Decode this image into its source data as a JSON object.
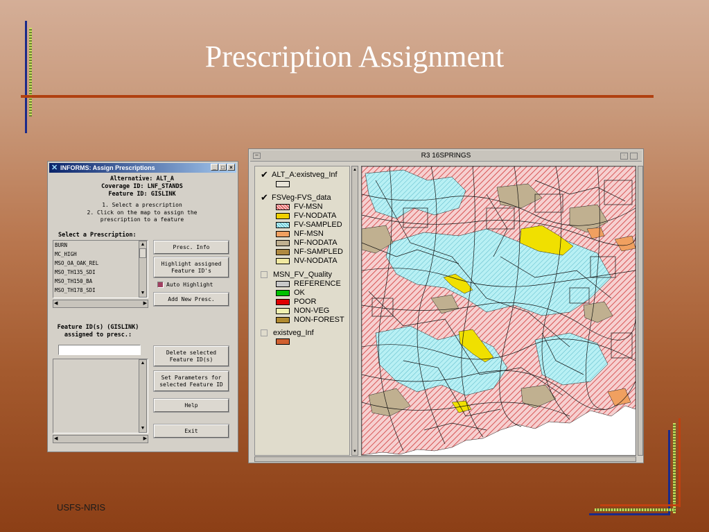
{
  "slide": {
    "title": "Prescription Assignment",
    "footer": "USFS-NRIS"
  },
  "dialog": {
    "title": "INFORMS: Assign Prescriptions",
    "window_buttons": [
      "_",
      "□",
      "×"
    ],
    "alternative": "Alternative: ALT_A",
    "coverage": "Coverage ID: LNF_STANDS",
    "feature": "Feature ID: GISLINK",
    "instruction_1": "1. Select a prescription",
    "instruction_2": "2. Click on the map to assign the",
    "instruction_3": "prescription to a feature",
    "select_label": "Select a Prescription:",
    "prescriptions": [
      "BURN",
      "MC_HIGH",
      "MSO_OA_OAK_REL",
      "MSO_TH135_SDI",
      "MSO_TH150_BA",
      "MSO_TH178_SDI"
    ],
    "presc_info_label": "Presc. Info",
    "highlight_label_1": "Highlight assigned",
    "highlight_label_2": "Feature ID's",
    "auto_highlight_label": "Auto Highlight",
    "add_presc_label": "Add New Presc.",
    "feature_ids_label_1": "Feature ID(s) (GISLINK)",
    "feature_ids_label_2": "assigned to presc.:",
    "delete_label_1": "Delete selected",
    "delete_label_2": "Feature ID(s)",
    "setparams_label_1": "Set Parameters for",
    "setparams_label_2": "selected Feature ID",
    "help_label": "Help",
    "exit_label": "Exit"
  },
  "map_window": {
    "title": "R3  16SPRINGS",
    "legend": [
      {
        "label": "ALT_A:existveg_Inf",
        "checked": true,
        "items": [
          {
            "label": "",
            "color": "#e8e4d8"
          }
        ]
      },
      {
        "label": "FSVeg-FVS_data",
        "checked": true,
        "items": [
          {
            "label": "FV-MSN",
            "color": "#f4c0c0"
          },
          {
            "label": "FV-NODATA",
            "color": "#f0d000"
          },
          {
            "label": "FV-SAMPLED",
            "color": "#a8ecf0"
          },
          {
            "label": "NF-MSN",
            "color": "#f0a060"
          },
          {
            "label": "NF-NODATA",
            "color": "#c0b090"
          },
          {
            "label": "NF-SAMPLED",
            "color": "#b08a40"
          },
          {
            "label": "NV-NODATA",
            "color": "#f0e8a0"
          }
        ]
      },
      {
        "label": "MSN_FV_Quality",
        "checked": false,
        "items": [
          {
            "label": "REFERENCE",
            "color": "#c8c8c8"
          },
          {
            "label": "OK",
            "color": "#00c000"
          },
          {
            "label": "POOR",
            "color": "#e00000"
          },
          {
            "label": "NON-VEG",
            "color": "#f0f0b0"
          },
          {
            "label": "NON-FOREST",
            "color": "#b08a30"
          }
        ]
      },
      {
        "label": "existveg_Inf",
        "checked": false,
        "items": [
          {
            "label": "",
            "color": "#d06030"
          }
        ]
      }
    ]
  }
}
